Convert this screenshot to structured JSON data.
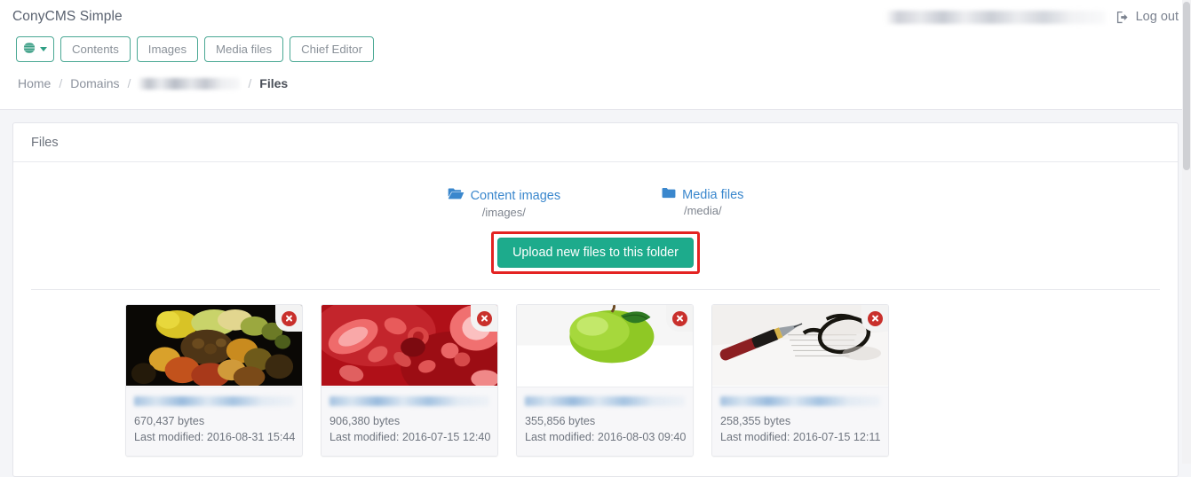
{
  "header": {
    "brand": "ConyCMS Simple",
    "username_redacted": "",
    "logout_label": "Log out",
    "logout_icon": "sign-out-icon"
  },
  "nav": {
    "language_icon": "globe-icon",
    "language_caret": "caret-down-icon",
    "buttons": [
      {
        "label": "Contents"
      },
      {
        "label": "Images"
      },
      {
        "label": "Media files"
      },
      {
        "label": "Chief Editor"
      }
    ]
  },
  "breadcrumb": {
    "items": [
      {
        "label": "Home",
        "active": false
      },
      {
        "label": "Domains",
        "active": false
      },
      {
        "label": "",
        "active": false,
        "redacted": true
      },
      {
        "label": "Files",
        "active": true
      }
    ],
    "separator": "/"
  },
  "panel": {
    "title": "Files"
  },
  "folders": [
    {
      "name": "Content images",
      "path": "/images/",
      "icon": "folder-open-icon",
      "color": "#3a87cd"
    },
    {
      "name": "Media files",
      "path": "/media/",
      "icon": "folder-closed-icon",
      "color": "#3a87cd"
    }
  ],
  "upload": {
    "label": "Upload new files to this folder",
    "button_color": "#1dab8c",
    "highlight_color": "#e42322"
  },
  "files": [
    {
      "name_redacted": "",
      "size": "670,437 bytes",
      "modified": "Last modified: 2016-08-31 15:44",
      "thumb": "still-life-fruit-painting",
      "delete_icon": "delete-circle-icon"
    },
    {
      "name_redacted": "",
      "size": "906,380 bytes",
      "modified": "Last modified: 2016-07-15 12:40",
      "thumb": "red-blood-cells",
      "delete_icon": "delete-circle-icon"
    },
    {
      "name_redacted": "",
      "size": "355,856 bytes",
      "modified": "Last modified: 2016-08-03 09:40",
      "thumb": "green-apple",
      "delete_icon": "delete-circle-icon"
    },
    {
      "name_redacted": "",
      "size": "258,355 bytes",
      "modified": "Last modified: 2016-07-15 12:11",
      "thumb": "pen-and-glasses",
      "delete_icon": "delete-circle-icon"
    }
  ]
}
